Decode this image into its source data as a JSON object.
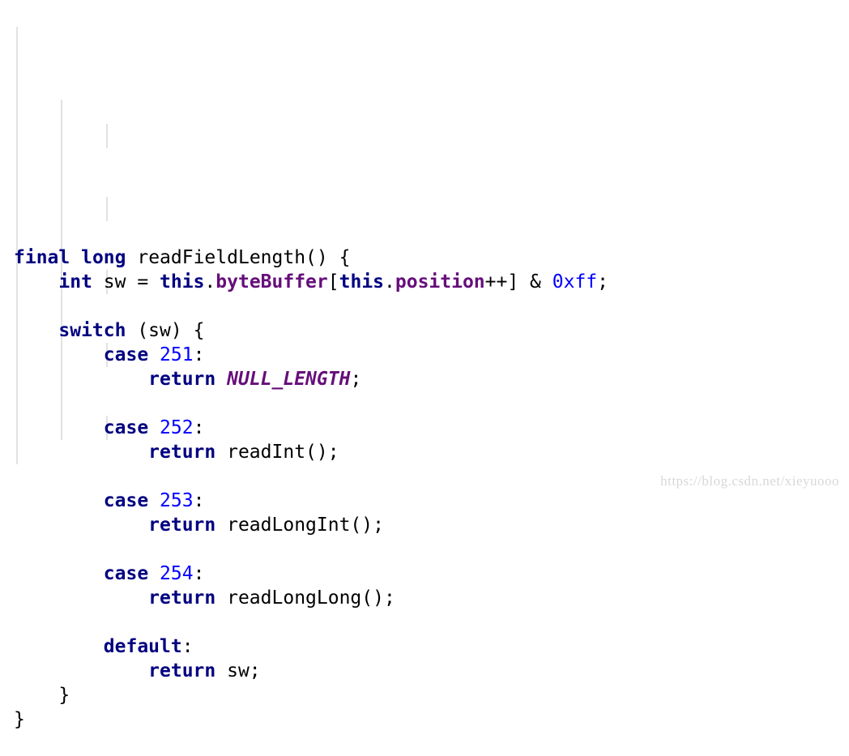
{
  "editor": {
    "language": "java",
    "lines": [
      [
        {
          "t": "kw",
          "v": "final"
        },
        {
          "t": "plain",
          "v": " "
        },
        {
          "t": "kw",
          "v": "long"
        },
        {
          "t": "plain",
          "v": " readFieldLength() {"
        }
      ],
      [
        {
          "t": "plain",
          "v": "    "
        },
        {
          "t": "kw",
          "v": "int"
        },
        {
          "t": "plain",
          "v": " sw = "
        },
        {
          "t": "kw",
          "v": "this"
        },
        {
          "t": "plain",
          "v": "."
        },
        {
          "t": "field",
          "v": "byteBuffer"
        },
        {
          "t": "plain",
          "v": "["
        },
        {
          "t": "kw",
          "v": "this"
        },
        {
          "t": "plain",
          "v": "."
        },
        {
          "t": "field",
          "v": "position"
        },
        {
          "t": "plain",
          "v": "++] & "
        },
        {
          "t": "num",
          "v": "0xff"
        },
        {
          "t": "plain",
          "v": ";"
        }
      ],
      [],
      [
        {
          "t": "plain",
          "v": "    "
        },
        {
          "t": "kw",
          "v": "switch"
        },
        {
          "t": "plain",
          "v": " (sw) {"
        }
      ],
      [
        {
          "t": "plain",
          "v": "        "
        },
        {
          "t": "kw",
          "v": "case"
        },
        {
          "t": "plain",
          "v": " "
        },
        {
          "t": "num",
          "v": "251"
        },
        {
          "t": "plain",
          "v": ":"
        }
      ],
      [
        {
          "t": "plain",
          "v": "            "
        },
        {
          "t": "kw",
          "v": "return"
        },
        {
          "t": "plain",
          "v": " "
        },
        {
          "t": "const",
          "v": "NULL_LENGTH"
        },
        {
          "t": "plain",
          "v": ";"
        }
      ],
      [],
      [
        {
          "t": "plain",
          "v": "        "
        },
        {
          "t": "kw",
          "v": "case"
        },
        {
          "t": "plain",
          "v": " "
        },
        {
          "t": "num",
          "v": "252"
        },
        {
          "t": "plain",
          "v": ":"
        }
      ],
      [
        {
          "t": "plain",
          "v": "            "
        },
        {
          "t": "kw",
          "v": "return"
        },
        {
          "t": "plain",
          "v": " readInt();"
        }
      ],
      [],
      [
        {
          "t": "plain",
          "v": "        "
        },
        {
          "t": "kw",
          "v": "case"
        },
        {
          "t": "plain",
          "v": " "
        },
        {
          "t": "num",
          "v": "253"
        },
        {
          "t": "plain",
          "v": ":"
        }
      ],
      [
        {
          "t": "plain",
          "v": "            "
        },
        {
          "t": "kw",
          "v": "return"
        },
        {
          "t": "plain",
          "v": " readLongInt();"
        }
      ],
      [],
      [
        {
          "t": "plain",
          "v": "        "
        },
        {
          "t": "kw",
          "v": "case"
        },
        {
          "t": "plain",
          "v": " "
        },
        {
          "t": "num",
          "v": "254"
        },
        {
          "t": "plain",
          "v": ":"
        }
      ],
      [
        {
          "t": "plain",
          "v": "            "
        },
        {
          "t": "kw",
          "v": "return"
        },
        {
          "t": "plain",
          "v": " readLongLong();"
        }
      ],
      [],
      [
        {
          "t": "plain",
          "v": "        "
        },
        {
          "t": "kw",
          "v": "default"
        },
        {
          "t": "plain",
          "v": ":"
        }
      ],
      [
        {
          "t": "plain",
          "v": "            "
        },
        {
          "t": "kw",
          "v": "return"
        },
        {
          "t": "plain",
          "v": " sw;"
        }
      ],
      [
        {
          "t": "plain",
          "v": "    }"
        }
      ],
      [
        {
          "t": "plain",
          "v": "}"
        }
      ]
    ]
  },
  "colors": {
    "keyword": "#000080",
    "number": "#0000ff",
    "field": "#660e7a",
    "text": "#000000",
    "indent_guide": "#e2e2e2",
    "watermark": "#d8d8d8"
  },
  "watermark": {
    "text": "https://blog.csdn.net/xieyuooo"
  }
}
